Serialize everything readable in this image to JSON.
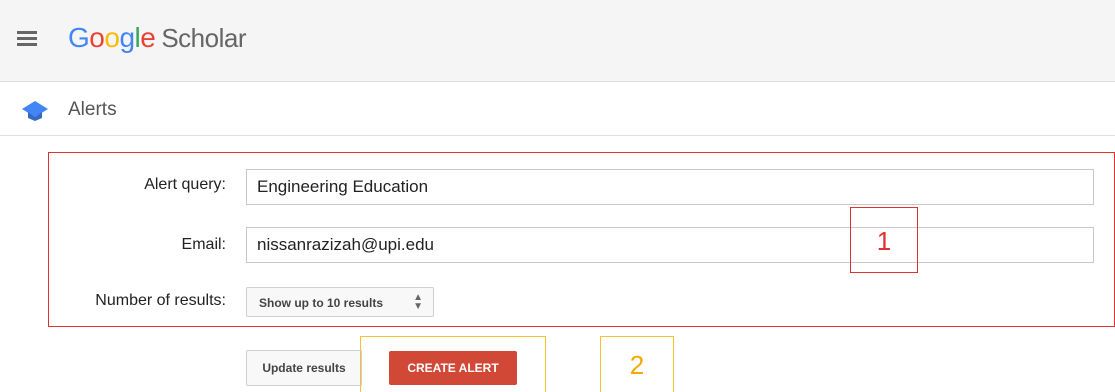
{
  "header": {
    "logo_parts": [
      "G",
      "o",
      "o",
      "g",
      "l",
      "e"
    ],
    "logo_product": "Scholar"
  },
  "subheader": {
    "title": "Alerts"
  },
  "form": {
    "alert_query_label": "Alert query:",
    "alert_query_value": "Engineering Education",
    "email_label": "Email:",
    "email_value": "nissanrazizah@upi.edu",
    "results_label": "Number of results:",
    "results_selected": "Show up to 10 results"
  },
  "buttons": {
    "update_label": "Update results",
    "create_label": "CREATE ALERT"
  },
  "annotations": {
    "marker_1": "1",
    "marker_2": "2",
    "color_1": "#e03030",
    "color_2": "#f2c230"
  },
  "colors": {
    "header_bg": "#f5f5f5",
    "create_button": "#d14836",
    "google_blue": "#4285f4",
    "google_red": "#ea4335",
    "google_yellow": "#fbbc05",
    "google_green": "#34a853"
  }
}
